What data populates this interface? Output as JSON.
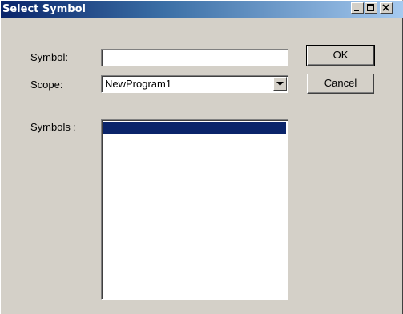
{
  "window": {
    "title": "Select Symbol"
  },
  "form": {
    "symbol_label": "Symbol:",
    "symbol_value": "",
    "scope_label": "Scope:",
    "scope_value": "NewProgram1",
    "symbols_label": "Symbols :"
  },
  "buttons": {
    "ok_label": "OK",
    "cancel_label": "Cancel"
  },
  "symbols_list": {
    "items": [
      ""
    ],
    "selected_index": 0
  },
  "colors": {
    "titlebar_start": "#0a246a",
    "titlebar_end": "#a6caf0",
    "face": "#d4d0c8",
    "selection": "#0a246a"
  },
  "icons": {
    "minimize": "minimize-icon",
    "maximize": "maximize-icon",
    "close": "close-icon",
    "dropdown": "chevron-down-icon"
  }
}
